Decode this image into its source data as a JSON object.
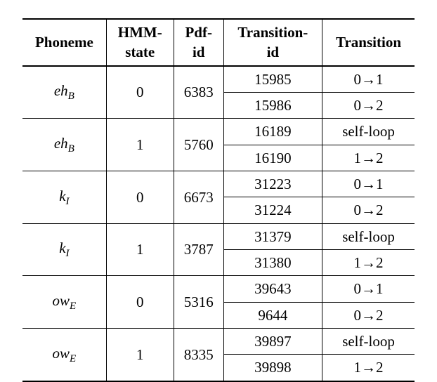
{
  "headers": {
    "phoneme": "Phoneme",
    "hmm": "HMM-\nstate",
    "pdf": "Pdf-\nid",
    "transid": "Transition-\nid",
    "transition": "Transition"
  },
  "rows": [
    {
      "phoneme_base": "eh",
      "phoneme_sub": "B",
      "hmm": "0",
      "pdf": "6383",
      "tr1_id": "15985",
      "tr1": "0→1",
      "tr2_id": "15986",
      "tr2": "0→2"
    },
    {
      "phoneme_base": "eh",
      "phoneme_sub": "B",
      "hmm": "1",
      "pdf": "5760",
      "tr1_id": "16189",
      "tr1": "self-loop",
      "tr2_id": "16190",
      "tr2": "1→2"
    },
    {
      "phoneme_base": "k",
      "phoneme_sub": "I",
      "hmm": "0",
      "pdf": "6673",
      "tr1_id": "31223",
      "tr1": "0→1",
      "tr2_id": "31224",
      "tr2": "0→2"
    },
    {
      "phoneme_base": "k",
      "phoneme_sub": "I",
      "hmm": "1",
      "pdf": "3787",
      "tr1_id": "31379",
      "tr1": "self-loop",
      "tr2_id": "31380",
      "tr2": "1→2"
    },
    {
      "phoneme_base": "ow",
      "phoneme_sub": "E",
      "hmm": "0",
      "pdf": "5316",
      "tr1_id": "39643",
      "tr1": "0→1",
      "tr2_id": "9644",
      "tr2": "0→2"
    },
    {
      "phoneme_base": "ow",
      "phoneme_sub": "E",
      "hmm": "1",
      "pdf": "8335",
      "tr1_id": "39897",
      "tr1": "self-loop",
      "tr2_id": "39898",
      "tr2": "1→2"
    }
  ]
}
